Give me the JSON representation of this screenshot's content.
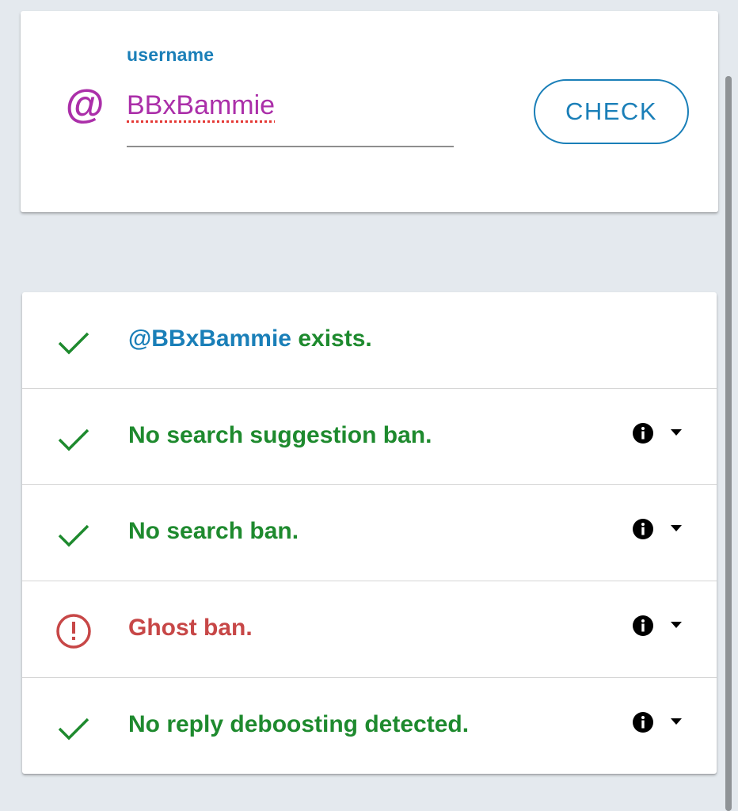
{
  "search": {
    "label": "username",
    "at_symbol": "@",
    "value": "BBxBammie",
    "button_label": "CHECK"
  },
  "results": {
    "exists": {
      "mention": "@BBxBammie",
      "suffix": " exists.",
      "status": "ok"
    },
    "items": [
      {
        "text": "No search suggestion ban.",
        "status": "ok"
      },
      {
        "text": "No search ban.",
        "status": "ok"
      },
      {
        "text": "Ghost ban.",
        "status": "error"
      },
      {
        "text": "No reply deboosting detected.",
        "status": "ok"
      }
    ]
  },
  "colors": {
    "accent_blue": "#1a7fb8",
    "ok_green": "#1e8a2e",
    "error_red": "#c74747",
    "username_purple": "#ab2fa9"
  }
}
